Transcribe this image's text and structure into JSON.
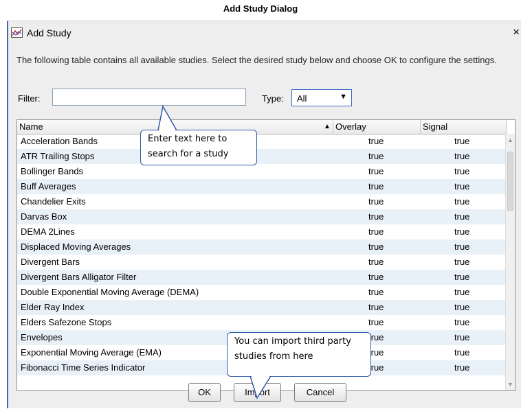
{
  "caption": "Add Study Dialog",
  "dialog": {
    "title": "Add Study",
    "close_label": "×",
    "description": "The following table contains all available studies. Select the desired study below and choose OK to configure the settings."
  },
  "filter": {
    "label": "Filter:",
    "value": ""
  },
  "type": {
    "label": "Type:",
    "selected": "All",
    "arrow": "▼"
  },
  "table": {
    "columns": {
      "name": "Name",
      "overlay": "Overlay",
      "signal": "Signal",
      "sort_arrow": "▲"
    },
    "rows": [
      {
        "name": "Acceleration Bands",
        "overlay": "true",
        "signal": "true"
      },
      {
        "name": "ATR Trailing Stops",
        "overlay": "true",
        "signal": "true"
      },
      {
        "name": "Bollinger Bands",
        "overlay": "true",
        "signal": "true"
      },
      {
        "name": "Buff Averages",
        "overlay": "true",
        "signal": "true"
      },
      {
        "name": "Chandelier Exits",
        "overlay": "true",
        "signal": "true"
      },
      {
        "name": "Darvas Box",
        "overlay": "true",
        "signal": "true"
      },
      {
        "name": "DEMA 2Lines",
        "overlay": "true",
        "signal": "true"
      },
      {
        "name": "Displaced Moving Averages",
        "overlay": "true",
        "signal": "true"
      },
      {
        "name": "Divergent Bars",
        "overlay": "true",
        "signal": "true"
      },
      {
        "name": "Divergent Bars Alligator Filter",
        "overlay": "true",
        "signal": "true"
      },
      {
        "name": "Double Exponential Moving Average (DEMA)",
        "overlay": "true",
        "signal": "true"
      },
      {
        "name": "Elder Ray Index",
        "overlay": "true",
        "signal": "true"
      },
      {
        "name": "Elders Safezone Stops",
        "overlay": "true",
        "signal": "true"
      },
      {
        "name": "Envelopes",
        "overlay": "true",
        "signal": "true"
      },
      {
        "name": "Exponential Moving Average (EMA)",
        "overlay": "true",
        "signal": "true"
      },
      {
        "name": "Fibonacci Time Series Indicator",
        "overlay": "true",
        "signal": "true"
      }
    ]
  },
  "buttons": {
    "ok": "OK",
    "import": "Import",
    "cancel": "Cancel"
  },
  "callouts": {
    "filter_hint": "Enter text here to search for a study",
    "import_hint": "You can import third party studies from here"
  },
  "colors": {
    "accent": "#3a67c4",
    "row_alt": "#e8f0f8",
    "callout_border": "#2e5aa8"
  }
}
